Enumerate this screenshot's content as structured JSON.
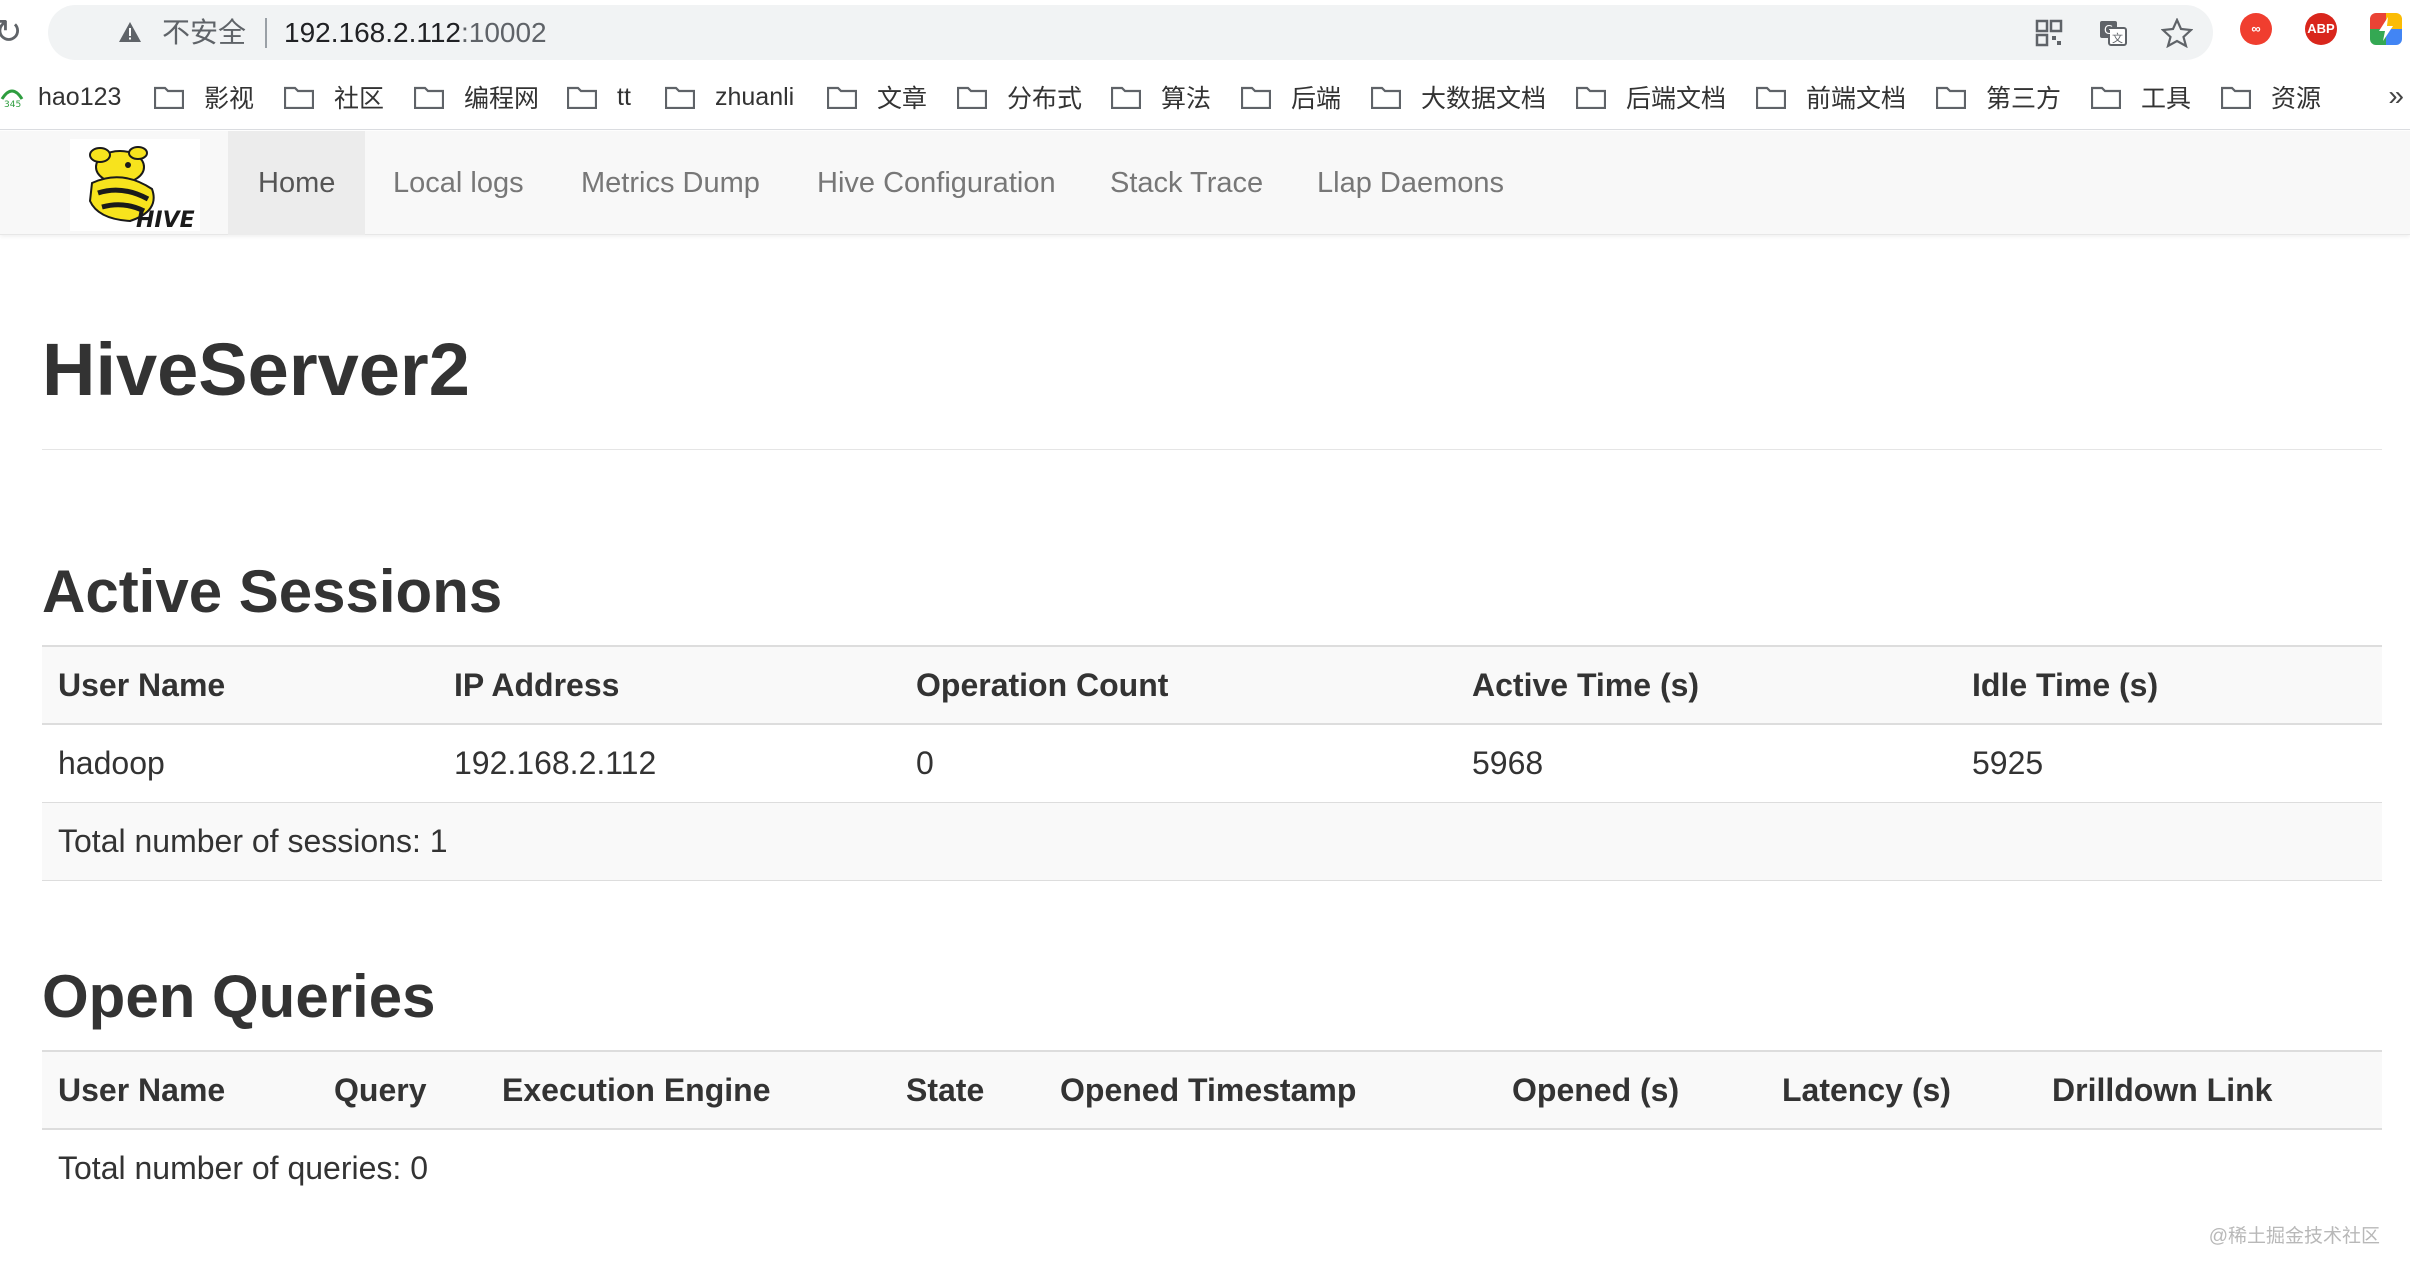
{
  "browser": {
    "insecure_label": "不安全",
    "url_host": "192.168.2.112",
    "url_port": ":10002",
    "ext_abp": "ABP",
    "bookmarks": [
      "hao123",
      "影视",
      "社区",
      "编程网",
      "tt",
      "zhuanli",
      "文章",
      "分布式",
      "算法",
      "后端",
      "大数据文档",
      "后端文档",
      "前端文档",
      "第三方",
      "工具",
      "资源"
    ],
    "more": "»"
  },
  "nav": {
    "logo_text": "HIVE",
    "items": [
      "Home",
      "Local logs",
      "Metrics Dump",
      "Hive Configuration",
      "Stack Trace",
      "Llap Daemons"
    ],
    "active": "Home"
  },
  "page": {
    "title": "HiveServer2"
  },
  "sessions": {
    "title": "Active Sessions",
    "columns": [
      "User Name",
      "IP Address",
      "Operation Count",
      "Active Time (s)",
      "Idle Time (s)"
    ],
    "rows": [
      [
        "hadoop",
        "192.168.2.112",
        "0",
        "5968",
        "5925"
      ]
    ],
    "total": "Total number of sessions: 1"
  },
  "queries": {
    "title": "Open Queries",
    "columns": [
      "User Name",
      "Query",
      "Execution Engine",
      "State",
      "Opened Timestamp",
      "Opened (s)",
      "Latency (s)",
      "Drilldown Link"
    ],
    "total": "Total number of queries: 0"
  },
  "watermark": "@稀土掘金技术社区"
}
